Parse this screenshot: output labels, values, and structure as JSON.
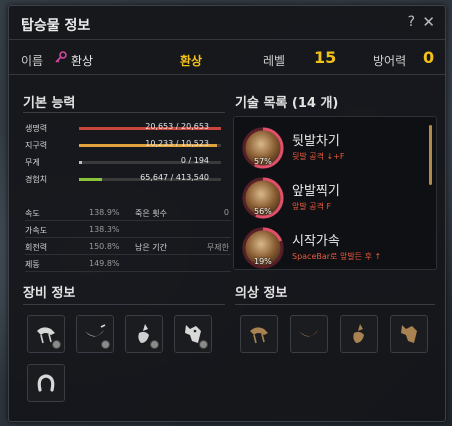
{
  "window": {
    "title": "탑승물 정보",
    "help_glyph": "?",
    "close_glyph": "✕"
  },
  "header": {
    "name_label": "이름",
    "name_value": "환상",
    "type_value": "환상",
    "level_label": "레벨",
    "level_value": "15",
    "defense_label": "방어력",
    "defense_value": "0"
  },
  "basic": {
    "title": "기본 능력",
    "stats": [
      {
        "label": "생명력",
        "value": "20,653 / 20,653",
        "fraction": 1.0,
        "color": "#c8463c"
      },
      {
        "label": "지구력",
        "value": "10,233 / 10,523",
        "fraction": 0.972,
        "color": "#e0a23c"
      },
      {
        "label": "무게",
        "value": "0 / 194",
        "fraction": 0.0,
        "color": "#bdbdbd"
      },
      {
        "label": "경험치",
        "value": "65,647 / 413,540",
        "fraction": 0.159,
        "color": "#8ac43c"
      }
    ],
    "attrs": [
      {
        "name": "속도",
        "value": "138.9%",
        "name2": "죽은 횟수",
        "value2": "0"
      },
      {
        "name": "가속도",
        "value": "138.3%",
        "name2": "",
        "value2": ""
      },
      {
        "name": "회전력",
        "value": "150.8%",
        "name2": "남은 기간",
        "value2": "무제한"
      },
      {
        "name": "제동",
        "value": "149.8%",
        "name2": "",
        "value2": ""
      }
    ]
  },
  "skills": {
    "title": "기술 목록 (14 개)",
    "items": [
      {
        "name": "뒷발차기",
        "desc": "뒷발 공격 ↓+F",
        "percent": "57%",
        "fraction": 0.57
      },
      {
        "name": "앞발찍기",
        "desc": "앞발 공격 F",
        "percent": "56%",
        "fraction": 0.56
      },
      {
        "name": "시작가속",
        "desc": "SpaceBar로 앞발든 후 ↑",
        "percent": "19%",
        "fraction": 0.19
      }
    ]
  },
  "equipment": {
    "title": "장비 정보",
    "slots": [
      "saddle-icon",
      "stirrups-icon",
      "barding-icon",
      "horse-mask-icon",
      "horseshoe-icon"
    ]
  },
  "costume": {
    "title": "의상 정보",
    "slots": [
      "costume-saddle-icon",
      "costume-stirrups-icon",
      "costume-barding-icon",
      "costume-mask-icon"
    ]
  },
  "colors": {
    "accent": "#f2c01a",
    "skill_ring": "#e0506a",
    "skill_desc": "#e85a3d"
  }
}
